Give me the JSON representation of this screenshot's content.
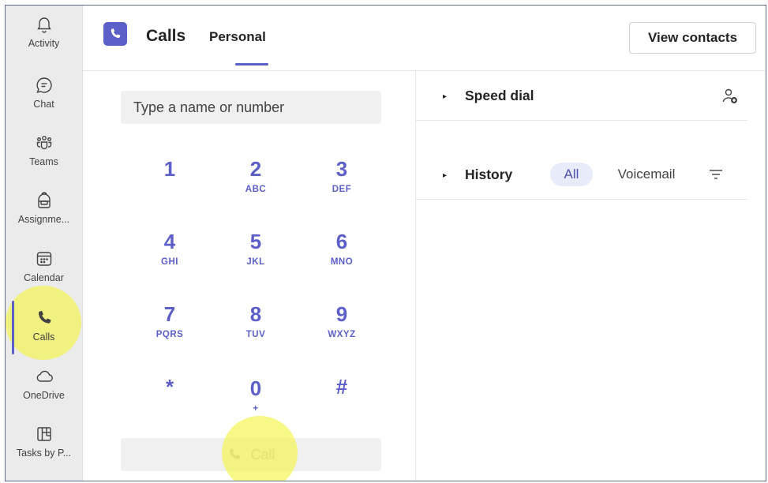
{
  "rail": {
    "items": [
      {
        "label": "Activity",
        "icon": "bell-icon"
      },
      {
        "label": "Chat",
        "icon": "chat-icon"
      },
      {
        "label": "Teams",
        "icon": "teams-icon"
      },
      {
        "label": "Assignme...",
        "icon": "backpack-icon"
      },
      {
        "label": "Calendar",
        "icon": "calendar-icon"
      },
      {
        "label": "Calls",
        "icon": "phone-icon"
      },
      {
        "label": "OneDrive",
        "icon": "cloud-icon"
      },
      {
        "label": "Tasks by P...",
        "icon": "planner-icon"
      }
    ],
    "active": "Calls"
  },
  "header": {
    "title": "Calls",
    "tab": "Personal",
    "view_contacts": "View contacts"
  },
  "dialpad": {
    "placeholder": "Type a name or number",
    "keys": [
      {
        "digit": "1",
        "letters": ""
      },
      {
        "digit": "2",
        "letters": "ABC"
      },
      {
        "digit": "3",
        "letters": "DEF"
      },
      {
        "digit": "4",
        "letters": "GHI"
      },
      {
        "digit": "5",
        "letters": "JKL"
      },
      {
        "digit": "6",
        "letters": "MNO"
      },
      {
        "digit": "7",
        "letters": "PQRS"
      },
      {
        "digit": "8",
        "letters": "TUV"
      },
      {
        "digit": "9",
        "letters": "WXYZ"
      },
      {
        "digit": "*",
        "letters": ""
      },
      {
        "digit": "0",
        "letters": "+"
      },
      {
        "digit": "#",
        "letters": ""
      }
    ],
    "call_label": "Call"
  },
  "right": {
    "speed_dial": "Speed dial",
    "history": "History",
    "filters": [
      "All",
      "Voicemail"
    ],
    "active_filter": "All"
  },
  "colors": {
    "accent": "#5b5fc7",
    "pill_bg": "#e8ebfa",
    "highlight": "#f5f546"
  }
}
